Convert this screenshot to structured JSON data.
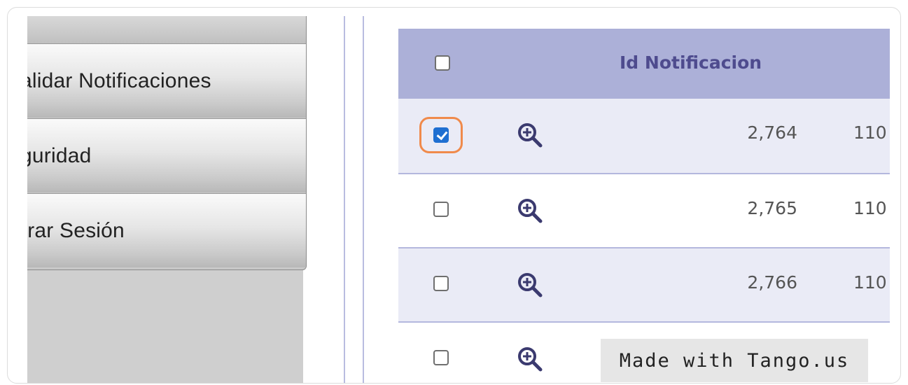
{
  "sidebar": {
    "items": [
      {
        "label": "alidar Notificaciones"
      },
      {
        "label": "guridad"
      },
      {
        "label": "rrar Sesión"
      }
    ]
  },
  "table": {
    "header": {
      "id_label": "Id Notificacion"
    },
    "rows": [
      {
        "checked": true,
        "id": "2,764",
        "next": "110"
      },
      {
        "checked": false,
        "id": "2,765",
        "next": "110"
      },
      {
        "checked": false,
        "id": "2,766",
        "next": "110"
      },
      {
        "checked": false,
        "id": "",
        "next": ""
      }
    ]
  },
  "watermark": {
    "text": "Made with Tango.us"
  },
  "colors": {
    "header_bg": "#acb0d8",
    "row_shade": "#eaebf6",
    "checkbox_checked": "#1f6fd1",
    "highlight": "#f08a4b",
    "zoom_icon": "#3b3a6f"
  }
}
